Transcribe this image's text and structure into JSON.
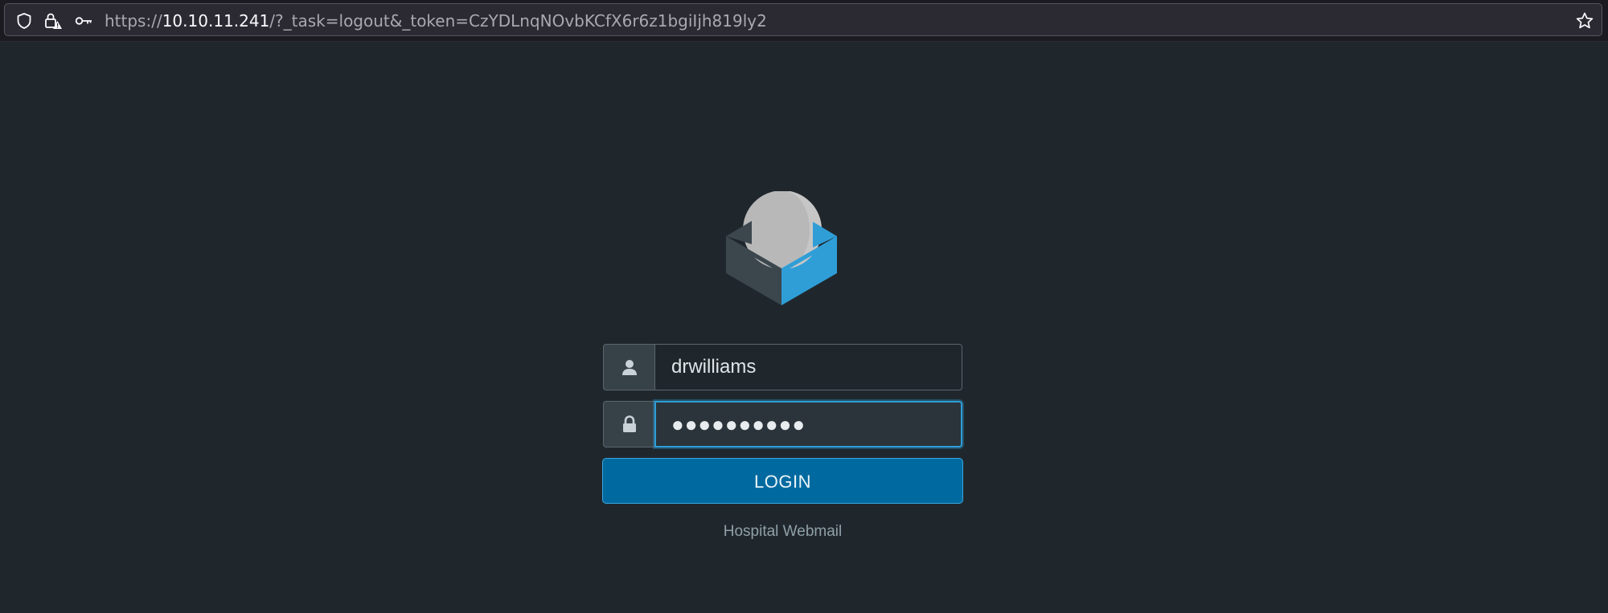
{
  "browser": {
    "url_prefix": "https://",
    "url_host": "10.10.11.241",
    "url_rest": "/?_task=logout&_token=CzYDLnqNOvbKCfX6r6z1bgiIjh819ly2",
    "icons": [
      "shield-icon",
      "lock-warning-icon",
      "key-icon",
      "bookmark-star-icon"
    ]
  },
  "login": {
    "logo_icon": "roundcube-logo",
    "username_icon": "user-icon",
    "username_value": "drwilliams",
    "password_icon": "lock-icon",
    "password_mask": "●●●●●●●●●●",
    "login_label": "LOGIN",
    "product_name": "Hospital Webmail"
  },
  "colors": {
    "background": "#20272c",
    "accent": "#2f9ed7",
    "button": "#006aa0"
  }
}
